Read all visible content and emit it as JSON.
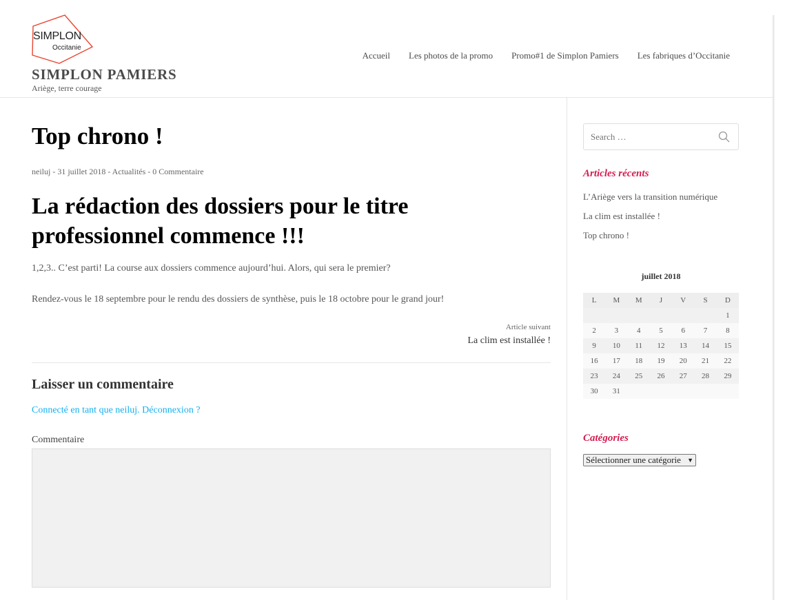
{
  "site": {
    "logo_main": "SIMPLON",
    "logo_sub": "Occitanie",
    "title": "SIMPLON PAMIERS",
    "tagline": "Ariège, terre courage"
  },
  "nav": [
    {
      "label": "Accueil"
    },
    {
      "label": "Les photos de la promo"
    },
    {
      "label": "Promo#1 de Simplon Pamiers"
    },
    {
      "label": "Les fabriques d’Occitanie"
    }
  ],
  "post": {
    "title": "Top chrono !",
    "meta": "neiluj - 31 juillet 2018 - Actualités - 0 Commentaire",
    "heading": "La rédaction des dossiers pour le titre professionnel commence !!!",
    "paragraphs": [
      "1,2,3.. C’est parti! La course aux dossiers commence aujourd’hui. Alors, qui sera le premier?",
      "Rendez-vous le 18 septembre pour le rendu des dossiers de synthèse, puis le 18 octobre pour le grand jour!"
    ],
    "next_label": "Article suivant",
    "next_title": "La clim est installée !"
  },
  "comments": {
    "title": "Laisser un commentaire",
    "logged_in": "Connecté en tant que neiluj. Déconnexion ?",
    "label": "Commentaire",
    "value": ""
  },
  "sidebar": {
    "search_placeholder": "Search …",
    "recent_title": "Articles récents",
    "recent": [
      "L’Ariège vers la transition numérique",
      "La clim est installée !",
      "Top chrono !"
    ],
    "calendar": {
      "title": "juillet 2018",
      "days": [
        "L",
        "M",
        "M",
        "J",
        "V",
        "S",
        "D"
      ],
      "weeks": [
        [
          "",
          "",
          "",
          "",
          "",
          "",
          "1"
        ],
        [
          "2",
          "3",
          "4",
          "5",
          "6",
          "7",
          "8"
        ],
        [
          "9",
          "10",
          "11",
          "12",
          "13",
          "14",
          "15"
        ],
        [
          "16",
          "17",
          "18",
          "19",
          "20",
          "21",
          "22"
        ],
        [
          "23",
          "24",
          "25",
          "26",
          "27",
          "28",
          "29"
        ],
        [
          "30",
          "31",
          "",
          "",
          "",
          "",
          ""
        ]
      ]
    },
    "categories_title": "Catégories",
    "categories_selected": "Sélectionner une catégorie"
  },
  "colors": {
    "accent": "#13aff0",
    "widget_title": "#d31c4e",
    "logo_border": "#e8452f"
  }
}
